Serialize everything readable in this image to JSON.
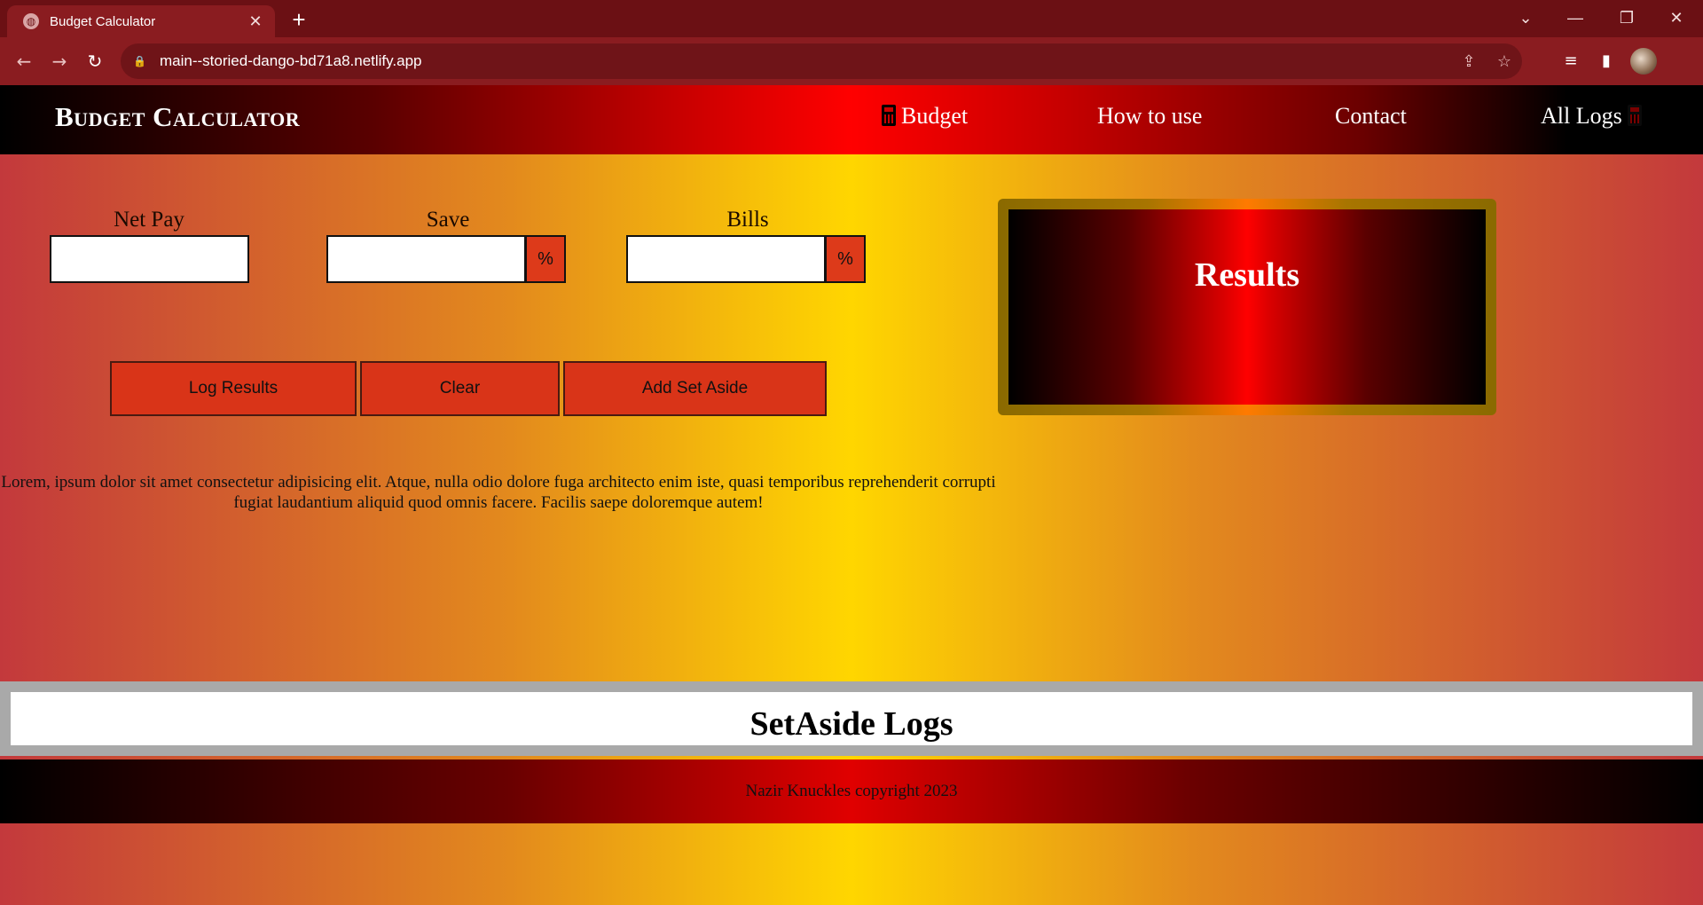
{
  "browser": {
    "tab_title": "Budget Calculator",
    "url": "main--storied-dango-bd71a8.netlify.app"
  },
  "nav": {
    "brand": "Budget Calculator",
    "links": [
      "Budget",
      "How to use",
      "Contact",
      "All Logs"
    ]
  },
  "form": {
    "net_pay_label": "Net Pay",
    "save_label": "Save",
    "bills_label": "Bills",
    "net_pay_value": "",
    "save_value": "",
    "bills_value": "",
    "percent_symbol": "%"
  },
  "buttons": {
    "log_results": "Log Results",
    "clear": "Clear",
    "add_set_aside": "Add Set Aside"
  },
  "body_text": "Lorem, ipsum dolor sit amet consectetur adipisicing elit. Atque, nulla odio dolore fuga architecto enim iste, quasi temporibus reprehenderit corrupti fugiat laudantium aliquid quod omnis facere. Facilis saepe doloremque autem!",
  "results": {
    "title": "Results"
  },
  "logs": {
    "title": "SetAside Logs"
  },
  "footer": {
    "text": "Nazir Knuckles copyright 2023"
  },
  "icons": {
    "favicon": "globe-icon",
    "budget_link_icon": "calculator-icon",
    "all_logs_icon": "calculator-icon"
  },
  "colors": {
    "button_bg": "#d93418",
    "results_border": "#a87500",
    "nav_center": "#ff0000",
    "page_center": "#ffd600"
  }
}
